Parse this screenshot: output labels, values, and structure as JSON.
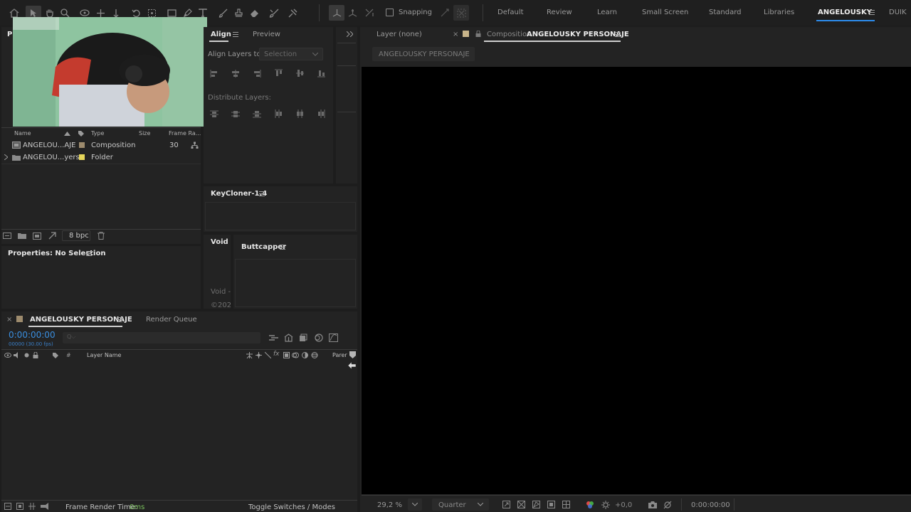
{
  "toolbar": {
    "snapping_label": "Snapping",
    "tools": [
      "home-icon",
      "selection-icon",
      "hand-icon",
      "zoom-icon",
      "orbit-camera-icon",
      "pan-camera-icon",
      "dolly-camera-icon",
      "rotate-icon",
      "anchor-icon",
      "rectangle-icon",
      "pen-icon",
      "type-icon",
      "brush-icon",
      "clone-stamp-icon",
      "eraser-icon",
      "roto-brush-icon",
      "puppet-pin-icon"
    ]
  },
  "workspaces": [
    "Default",
    "Review",
    "Learn",
    "Small Screen",
    "Standard",
    "Libraries",
    "ANGELOUSKY",
    "DUIK"
  ],
  "active_workspace": "ANGELOUSKY",
  "project": {
    "tab_label": "Pr",
    "columns": {
      "name": "Name",
      "type": "Type",
      "size": "Size",
      "frame_rate": "Frame Ra..."
    },
    "items": [
      {
        "name": "ANGELOU...AJE",
        "type": "Composition",
        "size": "",
        "frame_rate": "30",
        "label_color": "#9d8b6d"
      },
      {
        "name": "ANGELOU...yers",
        "type": "Folder",
        "size": "",
        "frame_rate": "",
        "label_color": "#e5d55a"
      }
    ],
    "bpc": "8 bpc"
  },
  "align": {
    "tab_align": "Align",
    "tab_preview": "Preview",
    "align_to_label": "Align Layers to:",
    "align_to_value": "Selection",
    "distribute_label": "Distribute Layers:"
  },
  "keycloner": {
    "title": "KeyCloner-1.4"
  },
  "void": {
    "title": "Void",
    "line1": "Void -",
    "line2": "©202"
  },
  "buttcapper": {
    "title": "Buttcapper"
  },
  "properties": {
    "title": "Properties: No Selection"
  },
  "viewer": {
    "layer_tab": "Layer (none)",
    "comp_tab_prefix": "Composition",
    "comp_tab_name": "ANGELOUSKY PERSONAJE",
    "comp_chip": "ANGELOUSKY PERSONAJE",
    "zoom": "29,2 %",
    "resolution": "Quarter",
    "exposure": "+0,0",
    "timecode": "0:00:00:00"
  },
  "timeline": {
    "comp_tab": "ANGELOUSKY PERSONAJE",
    "render_queue_tab": "Render Queue",
    "timecode": "0:00:00:00",
    "frame_info": "00000 (30.00 fps)",
    "search_placeholder": "Q⌵",
    "layer_name_header": "Layer Name",
    "parent_header": "Parer",
    "frame_render_label": "Frame Render Time:",
    "frame_render_value": "0ms",
    "toggle_label": "Toggle Switches / Modes"
  },
  "colors": {
    "accent": "#2d8ceb",
    "timecode": "#3a8fe0",
    "background": "#1d1d1d",
    "panel": "#232323",
    "viewer": "#000000",
    "render_time": "#79c05c"
  }
}
